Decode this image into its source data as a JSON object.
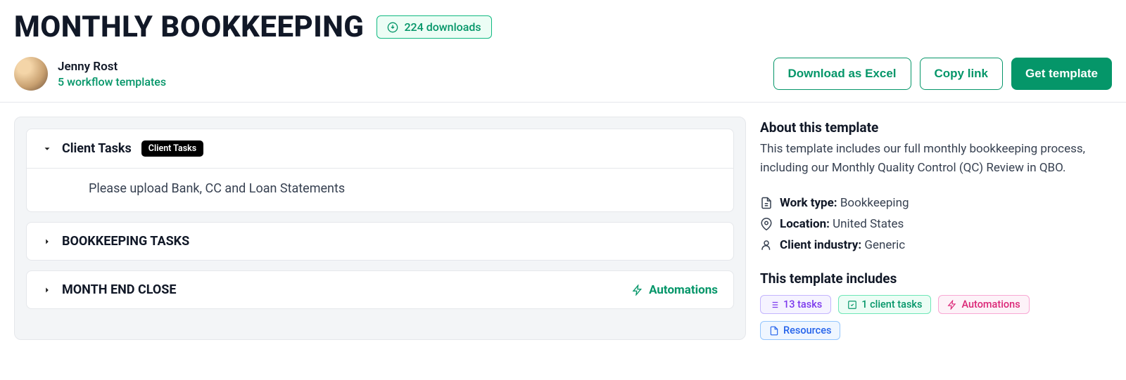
{
  "header": {
    "title": "MONTHLY BOOKKEEPING",
    "downloads": "224 downloads",
    "author_name": "Jenny Rost",
    "author_subtitle": "5 workflow templates",
    "actions": {
      "download_excel": "Download as Excel",
      "copy_link": "Copy link",
      "get_template": "Get template"
    }
  },
  "sections": [
    {
      "title": "Client Tasks",
      "chip": "Client Tasks",
      "expanded": true,
      "body": "Please upload Bank, CC and Loan Statements"
    },
    {
      "title": "BOOKKEEPING TASKS",
      "expanded": false
    },
    {
      "title": "MONTH END CLOSE",
      "expanded": false,
      "automations_label": "Automations"
    }
  ],
  "sidebar": {
    "about_title": "About this template",
    "about_text": "This template includes our full monthly bookkeeping process, including our Monthly Quality Control (QC) Review in QBO.",
    "meta": {
      "work_type_label": "Work type:",
      "work_type_value": "Bookkeeping",
      "location_label": "Location:",
      "location_value": "United States",
      "industry_label": "Client industry:",
      "industry_value": "Generic"
    },
    "includes_title": "This template includes",
    "chips": {
      "tasks": "13 tasks",
      "client_tasks": "1 client tasks",
      "automations": "Automations",
      "resources": "Resources"
    }
  }
}
